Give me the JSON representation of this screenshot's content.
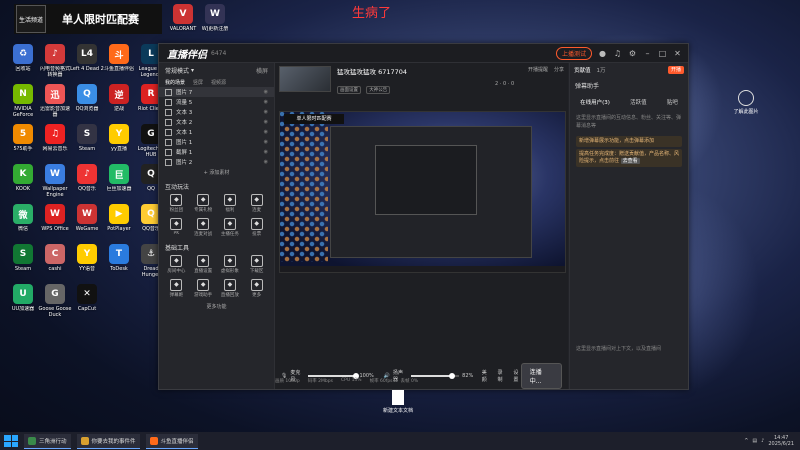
{
  "banner": {
    "logo_text": "生活频道",
    "title": "单人限时匹配赛"
  },
  "overlay_text": "生病了",
  "desktop_icons": [
    {
      "label": "回收站",
      "color": "#3b6fd1",
      "glyph": "♻"
    },
    {
      "label": "闪电音频格式转换器",
      "color": "#d33a3a",
      "glyph": "♪"
    },
    {
      "label": "Left 4 Dead 2",
      "color": "#333",
      "glyph": "L4"
    },
    {
      "label": "斗鱼直播伴侣",
      "color": "#ff6a1a",
      "glyph": "斗"
    },
    {
      "label": "League of Legends",
      "color": "#0b3a5a",
      "glyph": "L"
    },
    {
      "label": "VALORANT",
      "color": "#c33",
      "glyph": "V"
    },
    {
      "label": "WJ更新注册",
      "color": "#335",
      "glyph": "W"
    },
    {
      "label": "NVIDIA GeForce",
      "color": "#76b900",
      "glyph": "N"
    },
    {
      "label": "迅雷影音加速器",
      "color": "#e55",
      "glyph": "迅"
    },
    {
      "label": "QQ浏览器",
      "color": "#3a8ee6",
      "glyph": "Q"
    },
    {
      "label": "逆战",
      "color": "#c22",
      "glyph": "逆"
    },
    {
      "label": "Riot Client",
      "color": "#d22",
      "glyph": "R"
    },
    {
      "label": "5?5助手",
      "color": "#f08a00",
      "glyph": "5"
    },
    {
      "label": "网易云音乐",
      "color": "#e22",
      "glyph": "♫"
    },
    {
      "label": "Steam",
      "color": "#334",
      "glyph": "S"
    },
    {
      "label": "yy直播",
      "color": "#fc0",
      "glyph": "Y"
    },
    {
      "label": "Logitech G HUB",
      "color": "#111",
      "glyph": "G"
    },
    {
      "label": "KOOK",
      "color": "#3a3",
      "glyph": "K"
    },
    {
      "label": "Wallpaper Engine",
      "color": "#3a7de0",
      "glyph": "W"
    },
    {
      "label": "QQ音乐",
      "color": "#e33",
      "glyph": "♪"
    },
    {
      "label": "巨丝加速器",
      "color": "#2b6",
      "glyph": "巨"
    },
    {
      "label": "QQ",
      "color": "#222",
      "glyph": "Q"
    },
    {
      "label": "微信",
      "color": "#2aae67",
      "glyph": "微"
    },
    {
      "label": "WPS Office",
      "color": "#d22",
      "glyph": "W"
    },
    {
      "label": "WeGame",
      "color": "#c33",
      "glyph": "W"
    },
    {
      "label": "PotPlayer",
      "color": "#fc0",
      "glyph": "▶"
    },
    {
      "label": "QQ音乐",
      "color": "#fc3",
      "glyph": "Q"
    },
    {
      "label": "Steam",
      "color": "#173",
      "glyph": "S"
    },
    {
      "label": "cashi",
      "color": "#c66",
      "glyph": "C"
    },
    {
      "label": "YY语音",
      "color": "#fc0",
      "glyph": "Y"
    },
    {
      "label": "ToDesk",
      "color": "#2a7bde",
      "glyph": "T"
    },
    {
      "label": "Dread Hunger",
      "color": "#444",
      "glyph": "⚓"
    },
    {
      "label": "UU加速器",
      "color": "#2a6",
      "glyph": "U"
    },
    {
      "label": "Goose Goose Duck",
      "color": "#666",
      "glyph": "G"
    },
    {
      "label": "CapCut",
      "color": "#111",
      "glyph": "✕"
    }
  ],
  "window": {
    "app_title": "直播伴侣",
    "app_version": "6474",
    "orange_btn": "上播测试",
    "left": {
      "mode": "常规模式",
      "mode_right": "横屏",
      "tabs": [
        "我的场景",
        "竖屏",
        "视频源"
      ],
      "scenes": [
        {
          "label": "图片 7",
          "selected": true
        },
        {
          "label": "流量 5",
          "selected": false
        },
        {
          "label": "文本 3",
          "selected": false
        },
        {
          "label": "文本 2",
          "selected": false
        },
        {
          "label": "文本 1",
          "selected": false
        },
        {
          "label": "图片 1",
          "selected": false
        },
        {
          "label": "截屏 1",
          "selected": false
        },
        {
          "label": "图片 2",
          "selected": false
        }
      ],
      "add_material": "+ 添加素材",
      "interact_title": "互动玩法",
      "interact_tools": [
        "粉丝团",
        "专属礼物",
        "福利",
        "连麦",
        "PK",
        "连麦对战",
        "主播任务",
        "投票"
      ],
      "basic_title": "基础工具",
      "basic_tools": [
        "房间中心",
        "直播设置",
        "虚拟形象",
        "下载区",
        "弹幕姬",
        "游戏助手",
        "直播回放",
        "更多"
      ],
      "more": "更多功能"
    },
    "center": {
      "stream_name": "猛攻猛攻猛攻 6717704",
      "tags": [
        "画面设置",
        "大神公告"
      ],
      "head_right": [
        "开播提醒",
        "分享"
      ],
      "stats": [
        "2",
        "0",
        "0"
      ],
      "volume_mic_label": "麦克风",
      "volume_mic": "100%",
      "volume_sys_label": "扬声器",
      "volume_sys": "82%",
      "bottom_icons": [
        "美颜",
        "录制",
        "设置"
      ],
      "live_button": "连播中...",
      "status": [
        "画质 1080p",
        "码率 2Mbps",
        "CPU 13%",
        "帧率 60fps",
        "丢帧 0%"
      ]
    },
    "right": {
      "tabs": [
        "贡献值",
        "1万"
      ],
      "btn": "开播",
      "head": "弹幕助手",
      "subtabs": [
        "在线用户(3)",
        "活跃值",
        "贴吧"
      ],
      "hint": "这里显示直播间的互动信息、粉丝、关注等、弹幕消息等",
      "notice1": "新增弹幕展示功能，点击弹幕添加",
      "notice2": "提高任务完成度：赠送贡献值，产品名称、风险提示，点击前往",
      "notice_go": "去查看",
      "foot": "这里显示直播间对上下文，以及直播间"
    }
  },
  "desktop_file": "新建文本文档",
  "desktop_picture": "了解此图片",
  "taskbar": {
    "tasks": [
      "三角洲行动",
      "你要去我的事件件",
      "斗鱼直播伴侣"
    ],
    "time": "14:47",
    "date": "2025/6/21"
  }
}
